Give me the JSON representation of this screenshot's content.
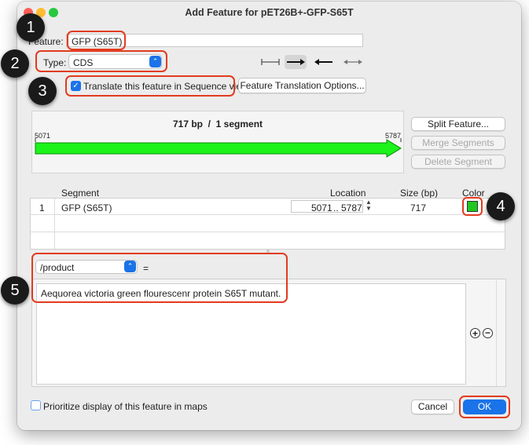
{
  "window": {
    "title": "Add Feature for pET26B+-GFP-S65T"
  },
  "feature": {
    "label": "Feature:",
    "value": "GFP (S65T)"
  },
  "type": {
    "label": "Type:",
    "value": "CDS",
    "directions": [
      "none",
      "forward",
      "reverse",
      "both"
    ]
  },
  "translate": {
    "checkbox_label": "Translate this feature in Sequence view",
    "checked": true,
    "options_button": "Feature Translation Options..."
  },
  "map": {
    "summary_bp": "717 bp",
    "separator": "/",
    "summary_segments": "1 segment",
    "start": "5071",
    "end": "5787",
    "arrow_color": "#1bf31b"
  },
  "segment_buttons": {
    "split": "Split Feature...",
    "merge": "Merge Segments",
    "delete": "Delete Segment"
  },
  "table": {
    "headers": {
      "segment": "Segment",
      "location": "Location",
      "size": "Size (bp)",
      "color": "Color"
    },
    "rows": [
      {
        "index": "1",
        "segment": "GFP (S65T)",
        "location_start": "5071",
        "location_sep": "..",
        "location_end": "5787",
        "size": "717",
        "color": "#22c722"
      }
    ]
  },
  "qualifier": {
    "key": "/product",
    "equals": "=",
    "value": "Aequorea victoria green flourescenr protein S65T mutant."
  },
  "footer": {
    "prioritize_label": "Prioritize display of this feature in maps",
    "cancel": "Cancel",
    "ok": "OK"
  },
  "markers": [
    "1",
    "2",
    "3",
    "4",
    "5"
  ],
  "accent_color": "#1a73e8",
  "highlight_color": "#e23b1f"
}
